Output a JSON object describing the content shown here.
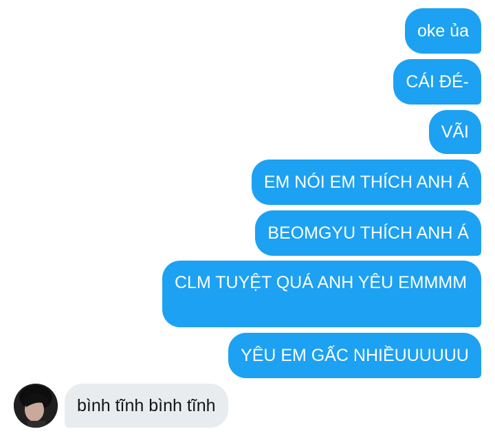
{
  "colors": {
    "outgoing_bubble": "#1da1f2",
    "incoming_bubble": "#e9ecef",
    "background": "#ffffff"
  },
  "messages": [
    {
      "direction": "outgoing",
      "text": "oke ủa"
    },
    {
      "direction": "outgoing",
      "text": "CÁI ĐÉ-"
    },
    {
      "direction": "outgoing",
      "text": "VÃI"
    },
    {
      "direction": "outgoing",
      "text": "EM NÓI EM THÍCH ANH Á"
    },
    {
      "direction": "outgoing",
      "text": "BEOMGYU THÍCH ANH Á"
    },
    {
      "direction": "outgoing",
      "text": "CLM TUYỆT QUÁ ANH YÊU EMMMM"
    },
    {
      "direction": "outgoing",
      "text": "YÊU EM GẤC NHIỀUUUUUU"
    },
    {
      "direction": "incoming",
      "text": "bình tĩnh bình tĩnh",
      "avatar_icon": "user-avatar"
    }
  ]
}
